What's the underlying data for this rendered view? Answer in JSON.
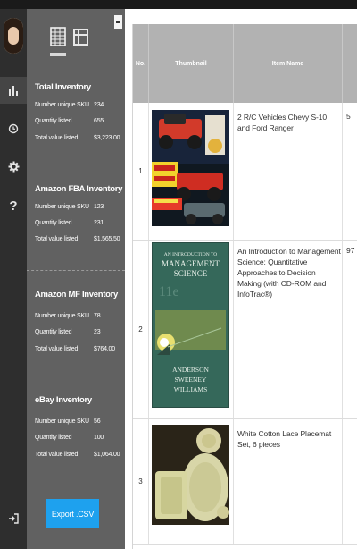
{
  "sidebar_icons": [
    "bar-chart-icon",
    "history-icon",
    "gear-icon",
    "help-icon",
    "logout-icon"
  ],
  "help_glyph": "?",
  "panel": {
    "tabs": [
      "grid-view-icon",
      "frame-view-icon"
    ],
    "sections": [
      {
        "title": "Total Inventory",
        "rows": [
          {
            "label": "Number unique SKU",
            "value": "234"
          },
          {
            "label": "Quantity listed",
            "value": "655"
          },
          {
            "label": "Total value listed",
            "value": "$3,223.00"
          }
        ]
      },
      {
        "title": "Amazon FBA Inventory",
        "rows": [
          {
            "label": "Number unique SKU",
            "value": "123"
          },
          {
            "label": "Quantity listed",
            "value": "231"
          },
          {
            "label": "Total value listed",
            "value": "$1,565.50"
          }
        ]
      },
      {
        "title": "Amazon MF Inventory",
        "rows": [
          {
            "label": "Number unique SKU",
            "value": "78"
          },
          {
            "label": "Quantity listed",
            "value": "23"
          },
          {
            "label": "Total value listed",
            "value": "$764.00"
          }
        ]
      },
      {
        "title": "eBay Inventory",
        "rows": [
          {
            "label": "Number unique SKU",
            "value": "56"
          },
          {
            "label": "Quantity listed",
            "value": "100"
          },
          {
            "label": "Total value listed",
            "value": "$1,064.00"
          }
        ]
      }
    ],
    "export_label": "Export .CSV"
  },
  "table": {
    "columns": [
      "No.",
      "Thumbnail",
      "Item Name"
    ],
    "rows": [
      {
        "no": "1",
        "thumbnail": "rc-vehicles-box-image",
        "name": "2 R/C Vehicles Chevy S-10 and Ford Ranger",
        "clipped": "5"
      },
      {
        "no": "2",
        "thumbnail": "management-science-book-cover",
        "name": "An Introduction to Management Science: Quantitative Approaches to Decision Making (with CD-ROM and InfoTrac®)",
        "clipped": "97"
      },
      {
        "no": "3",
        "thumbnail": "lace-placemat-photo",
        "name": "White Cotton Lace Placemat Set, 6 pieces",
        "clipped": ""
      }
    ]
  },
  "book_cover": {
    "title_line1": "AN INTRODUCTION TO",
    "title_line2": "MANAGEMENT",
    "title_line3": "SCIENCE",
    "edition": "11e",
    "authors": [
      "ANDERSON",
      "SWEENEY",
      "WILLIAMS"
    ]
  },
  "colors": {
    "rail": "#2e2e2e",
    "panel": "#616161",
    "accent": "#1ea1ee",
    "table_header": "#b2b2b2"
  }
}
